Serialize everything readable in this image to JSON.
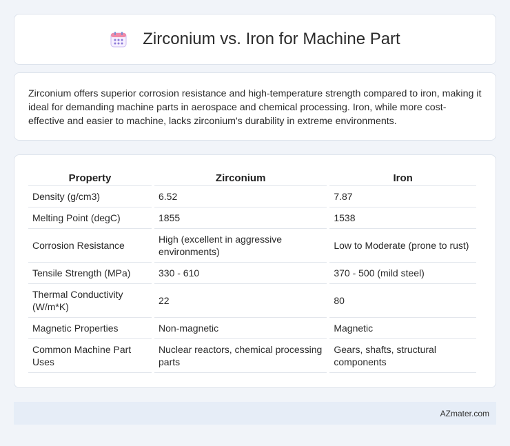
{
  "header": {
    "title": "Zirconium vs. Iron for Machine Part",
    "icon": "calendar-icon"
  },
  "summary": {
    "text": "Zirconium offers superior corrosion resistance and high-temperature strength compared to iron, making it ideal for demanding machine parts in aerospace and chemical processing. Iron, while more cost-effective and easier to machine, lacks zirconium's durability in extreme environments."
  },
  "table": {
    "headers": [
      "Property",
      "Zirconium",
      "Iron"
    ],
    "rows": [
      [
        "Density (g/cm3)",
        "6.52",
        "7.87"
      ],
      [
        "Melting Point (degC)",
        "1855",
        "1538"
      ],
      [
        "Corrosion Resistance",
        "High (excellent in aggressive environments)",
        "Low to Moderate (prone to rust)"
      ],
      [
        "Tensile Strength (MPa)",
        "330 - 610",
        "370 - 500 (mild steel)"
      ],
      [
        "Thermal Conductivity (W/m*K)",
        "22",
        "80"
      ],
      [
        "Magnetic Properties",
        "Non-magnetic",
        "Magnetic"
      ],
      [
        "Common Machine Part Uses",
        "Nuclear reactors, chemical processing parts",
        "Gears, shafts, structural components"
      ]
    ]
  },
  "footer": {
    "text": "AZmater.com"
  }
}
